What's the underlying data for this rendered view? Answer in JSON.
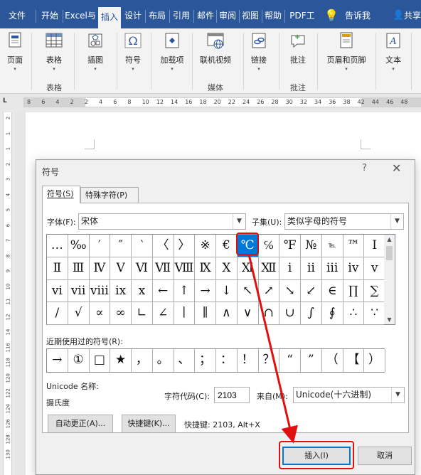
{
  "ribbon_tabs": [
    "文件",
    "开始",
    "Excel与",
    "插入",
    "设计",
    "布局",
    "引用",
    "邮件",
    "审阅",
    "视图",
    "帮助",
    "PDF工",
    "告诉我",
    "共享"
  ],
  "ribbon": {
    "buttons": {
      "page": "页面",
      "table": "表格",
      "illustration": "插图",
      "symbol": "符号",
      "addins": "加载项",
      "online_video": "联机视频",
      "link": "链接",
      "comment": "批注",
      "header_footer": "页眉和页脚",
      "text": "文本"
    },
    "groups": {
      "table": "表格",
      "media": "媒体",
      "comment": "批注"
    }
  },
  "ruler": {
    "numbers": [
      "8",
      "6",
      "4",
      "2",
      "2",
      "4",
      "6",
      "8",
      "10",
      "12",
      "14",
      "16",
      "18",
      "20",
      "22",
      "24",
      "26",
      "28",
      "30",
      "32",
      "34",
      "36",
      "38",
      "42",
      "44",
      "46",
      "48"
    ],
    "vertical": [
      "2",
      "1",
      "1",
      "2",
      "3",
      "4",
      "5",
      "6",
      "7",
      "8",
      "9",
      "10",
      "11",
      "12",
      "14",
      "116",
      "118",
      "120",
      "122",
      "124",
      "126",
      "128",
      "130"
    ]
  },
  "dialog": {
    "title": "符号",
    "help": "?",
    "close": "✕",
    "tab_symbols": "符号(S)",
    "tab_special": "特殊字符(P)",
    "font_label": "字体(F):",
    "font_value": "宋体",
    "subset_label": "子集(U):",
    "subset_value": "类似字母的符号",
    "symbols": [
      "…",
      "‰",
      "′",
      "″",
      "‵",
      "〈",
      "〉",
      "※",
      "€",
      "℃",
      "℅",
      "℉",
      "№",
      "℡",
      "™",
      "Ⅰ",
      "Ⅱ",
      "Ⅲ",
      "Ⅳ",
      "Ⅴ",
      "Ⅵ",
      "Ⅶ",
      "Ⅷ",
      "Ⅸ",
      "Ⅹ",
      "Ⅺ",
      "Ⅻ",
      "ⅰ",
      "ⅱ",
      "ⅲ",
      "ⅳ",
      "ⅴ",
      "ⅵ",
      "ⅶ",
      "ⅷ",
      "ⅸ",
      "ⅹ",
      "←",
      "↑",
      "→",
      "↓",
      "↖",
      "↗",
      "↘",
      "↙",
      "∈",
      "∏",
      "∑",
      "∕",
      "√",
      "∝",
      "∞",
      "∟",
      "∠",
      "∣",
      "∥",
      "∧",
      "∨",
      "∩",
      "∪",
      "∫",
      "∮",
      "∴",
      "∵"
    ],
    "recent_label": "近期使用过的符号(R):",
    "recent": [
      "→",
      "①",
      "□",
      "★",
      "，",
      "。",
      "、",
      "；",
      "：",
      "！",
      "？",
      "“",
      "”",
      "（",
      "【",
      "）"
    ],
    "unicode_name_label": "Unicode 名称:",
    "unicode_name": "摄氏度",
    "char_code_label": "字符代码(C):",
    "char_code": "2103",
    "from_label": "来自(M):",
    "from_value": "Unicode(十六进制)",
    "autocorrect_btn": "自动更正(A)...",
    "shortcut_btn": "快捷键(K)...",
    "shortcut_text": "快捷键: 2103, Alt+X",
    "insert_btn": "插入(I)",
    "cancel_btn": "取消"
  },
  "selected_symbol_index": 9,
  "colors": {
    "accent": "#2b579a",
    "selection": "#0078d7",
    "highlight": "#e01010"
  }
}
